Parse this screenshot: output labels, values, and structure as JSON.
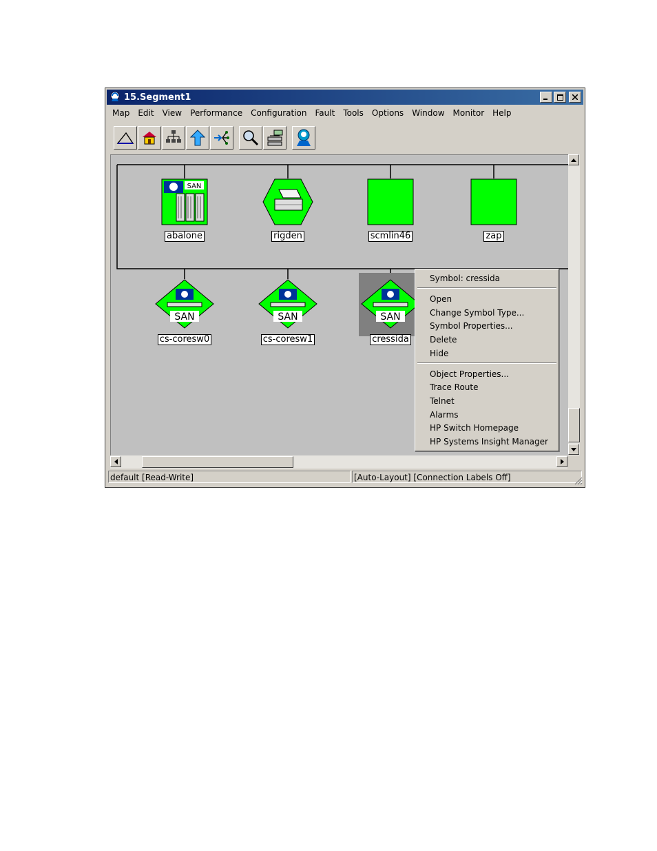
{
  "window": {
    "title": "15.Segment1"
  },
  "menubar": [
    "Map",
    "Edit",
    "View",
    "Performance",
    "Configuration",
    "Fault",
    "Tools",
    "Options",
    "Window",
    "Monitor",
    "Help"
  ],
  "toolbar": {
    "icons": [
      "up-level-icon",
      "home-icon",
      "root-map-icon",
      "parent-icon",
      "quick-navigator-icon",
      "find-icon",
      "network-node-icon",
      "hp-logo-icon"
    ]
  },
  "nodes_top": [
    {
      "label": "abalone",
      "badge": "SAN"
    },
    {
      "label": "rigden"
    },
    {
      "label": "scmlin46"
    },
    {
      "label": "zap"
    }
  ],
  "nodes_bottom": [
    {
      "label": "cs-coresw0",
      "badge": "SAN"
    },
    {
      "label": "cs-coresw1",
      "badge": "SAN"
    },
    {
      "label": "cressida",
      "badge": "SAN"
    }
  ],
  "context_menu": {
    "header": "Symbol: cressida",
    "group1": [
      "Open",
      "Change Symbol Type...",
      "Symbol Properties...",
      "Delete",
      "Hide"
    ],
    "group2": [
      "Object Properties...",
      "Trace Route",
      "Telnet",
      "Alarms",
      "HP Switch Homepage",
      "HP Systems Insight Manager"
    ]
  },
  "status": {
    "left": "default [Read-Write]",
    "right": "[Auto-Layout] [Connection Labels Off]"
  },
  "colors": {
    "node_fill": "#00ff00",
    "canvas": "#c0c0c0",
    "titlebar": "#0a246a"
  }
}
